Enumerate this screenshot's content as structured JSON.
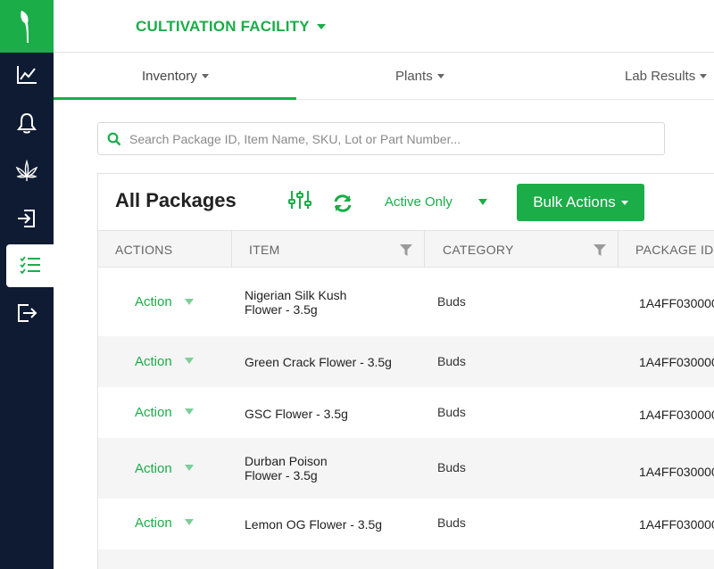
{
  "header": {
    "facility": "CULTIVATION FACILITY"
  },
  "tabs": [
    {
      "label": "Inventory"
    },
    {
      "label": "Plants"
    },
    {
      "label": "Lab Results"
    }
  ],
  "search": {
    "placeholder": "Search Package ID, Item Name, SKU, Lot or Part Number..."
  },
  "panel": {
    "title": "All Packages",
    "filter_label": "Active Only",
    "bulk_label": "Bulk Actions"
  },
  "table": {
    "columns": [
      "ACTIONS",
      "ITEM",
      "CATEGORY",
      "PACKAGE ID"
    ],
    "rows": [
      {
        "action": "Action",
        "item_line1": "Nigerian Silk Kush",
        "item_line2": "Flower - 3.5g",
        "category": "Buds",
        "package_id": "1A4FF030000"
      },
      {
        "action": "Action",
        "item_line1": "Green Crack Flower - 3.5g",
        "item_line2": "",
        "category": "Buds",
        "package_id": "1A4FF030000"
      },
      {
        "action": "Action",
        "item_line1": "GSC Flower - 3.5g",
        "item_line2": "",
        "category": "Buds",
        "package_id": "1A4FF030000"
      },
      {
        "action": "Action",
        "item_line1": "Durban Poison",
        "item_line2": "Flower - 3.5g",
        "category": "Buds",
        "package_id": "1A4FF030000"
      },
      {
        "action": "Action",
        "item_line1": "Lemon OG Flower - 3.5g",
        "item_line2": "",
        "category": "Buds",
        "package_id": "1A4FF030000"
      }
    ]
  },
  "colors": {
    "accent": "#1aad48",
    "sidebar": "#0f1b33"
  }
}
